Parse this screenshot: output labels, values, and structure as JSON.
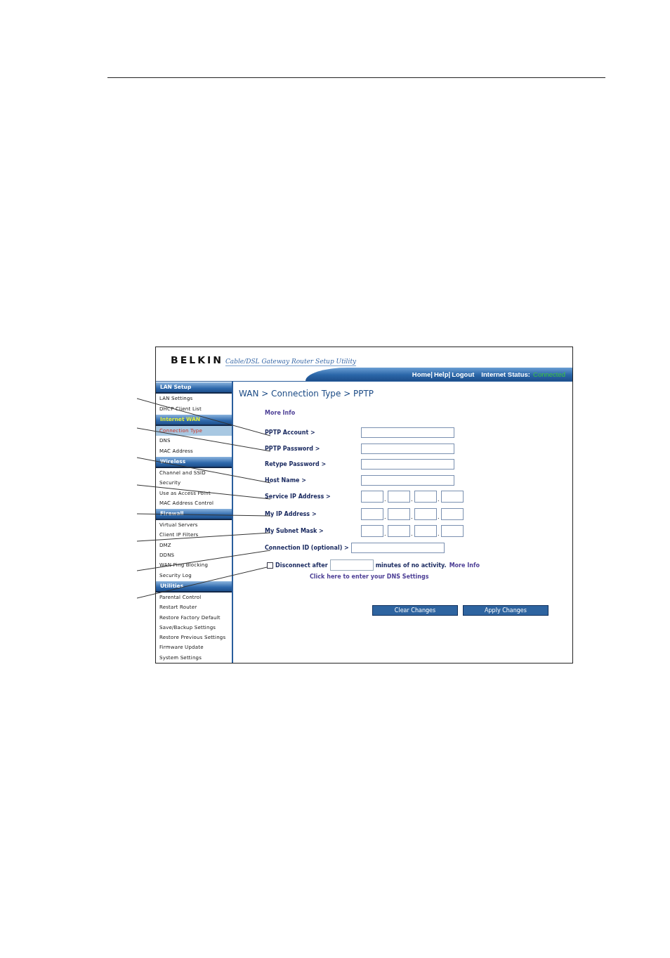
{
  "header": {
    "logo": "BELKIN",
    "tagline": "Cable/DSL Gateway Router Setup Utility",
    "nav": [
      {
        "label": "Home|"
      },
      {
        "label": "Help|"
      },
      {
        "label": "Logout"
      }
    ],
    "status_label": "Internet Status:",
    "status_value": "Connected"
  },
  "sidebar": {
    "sections": [
      {
        "title": "LAN Setup",
        "active": false,
        "items": [
          {
            "label": "LAN Settings",
            "selected": false
          },
          {
            "label": "DHCP Client List",
            "selected": false
          }
        ]
      },
      {
        "title": "Internet WAN",
        "active": true,
        "items": [
          {
            "label": "Connection Type",
            "selected": true
          },
          {
            "label": "DNS",
            "selected": false
          },
          {
            "label": "MAC Address",
            "selected": false
          }
        ]
      },
      {
        "title": "Wireless",
        "active": false,
        "items": [
          {
            "label": "Channel and SSID",
            "selected": false
          },
          {
            "label": "Security",
            "selected": false
          },
          {
            "label": "Use as Access Point",
            "selected": false
          },
          {
            "label": "MAC Address Control",
            "selected": false
          }
        ]
      },
      {
        "title": "Firewall",
        "active": false,
        "items": [
          {
            "label": "Virtual Servers",
            "selected": false
          },
          {
            "label": "Client IP Filters",
            "selected": false
          },
          {
            "label": "DMZ",
            "selected": false
          },
          {
            "label": "DDNS",
            "selected": false
          },
          {
            "label": "WAN Ping Blocking",
            "selected": false
          },
          {
            "label": "Security Log",
            "selected": false
          }
        ]
      },
      {
        "title": "Utilities",
        "active": false,
        "items": [
          {
            "label": "Parental Control",
            "selected": false
          },
          {
            "label": "Restart Router",
            "selected": false
          },
          {
            "label": "Restore Factory Default",
            "selected": false
          },
          {
            "label": "Save/Backup Settings",
            "selected": false
          },
          {
            "label": "Restore Previous Settings",
            "selected": false
          },
          {
            "label": "Firmware Update",
            "selected": false
          },
          {
            "label": "System Settings",
            "selected": false
          }
        ]
      }
    ]
  },
  "content": {
    "title": "WAN > Connection Type > PPTP",
    "more_info": "More Info",
    "fields": [
      {
        "kind": "text",
        "label": "PPTP Account >"
      },
      {
        "kind": "text",
        "label": "PPTP Password >"
      },
      {
        "kind": "text",
        "label": "Retype Password >"
      },
      {
        "kind": "text",
        "label": "Host Name >"
      },
      {
        "kind": "ip",
        "label": "Service IP Address >",
        "separators": [
          ".",
          ".",
          "."
        ]
      },
      {
        "kind": "ip",
        "label": "My IP Address >",
        "separators": [
          ".",
          ".",
          "."
        ]
      },
      {
        "kind": "ip",
        "label": "My Subnet Mask >",
        "separators": [
          ".",
          ".",
          "."
        ]
      },
      {
        "kind": "text",
        "label": "Connection ID (optional) >"
      }
    ],
    "disconnect": {
      "checked": false,
      "label": "Disconnect after",
      "suffix": "minutes of no activity.",
      "link": "More Info"
    },
    "dns_link": "Click here to enter your DNS Settings",
    "buttons": [
      "Clear Changes",
      "Apply Changes"
    ]
  }
}
